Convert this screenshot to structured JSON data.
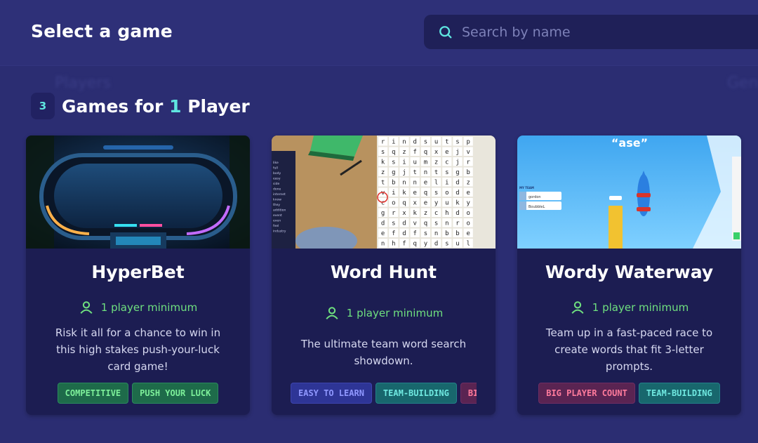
{
  "header": {
    "title": "Select a game",
    "search": {
      "placeholder": "Search by name",
      "value": "",
      "icon": "search-icon"
    }
  },
  "background_ghost": {
    "left": "Players",
    "right": "Gen"
  },
  "section": {
    "count": "3",
    "title_prefix": "Games for ",
    "title_highlight": "1",
    "title_suffix": " Player"
  },
  "colors": {
    "accent": "#5fe6e0",
    "player_text": "#6fe07f",
    "card_bg": "#1c1d52",
    "page_bg": "#2b2d72"
  },
  "games": [
    {
      "title": "HyperBet",
      "players": "1 player minimum",
      "description": "Risk it all for a chance to win in this high stakes push-your-luck card game!",
      "tags": [
        "COMPETITIVE",
        "PUSH YOUR LUCK"
      ]
    },
    {
      "title": "Word Hunt",
      "players": "1 player minimum",
      "description": "The ultimate team word search showdown.",
      "tags": [
        "EASY TO LEARN",
        "TEAM-BUILDING",
        "BIG"
      ],
      "word_list": [
        "like",
        "full",
        "body",
        "easy",
        "side",
        "done",
        "internet",
        "know",
        "they",
        "addition",
        "event",
        "even",
        "feel",
        "industry"
      ],
      "grid_rows": [
        "rindsutsp",
        "sqzfqxejv",
        "ksiumzcjr",
        "zgjtntsgb",
        "tbnnelidz",
        "vikeqsode",
        "coqxeyuky",
        "grxkzchdo",
        "dsdvqsnro",
        "efdfsnbbe",
        "nhfqydsul"
      ]
    },
    {
      "title": "Wordy Waterway",
      "players": "1 player minimum",
      "description": "Team up in a fast-paced race to create words that fit 3-letter prompts.",
      "tags": [
        "BIG PLAYER COUNT",
        "TEAM-BUILDING"
      ],
      "prompt": "“ase”",
      "team_label": "MY TEAM",
      "team_members": [
        "gordon",
        "BoubbleL"
      ]
    }
  ]
}
